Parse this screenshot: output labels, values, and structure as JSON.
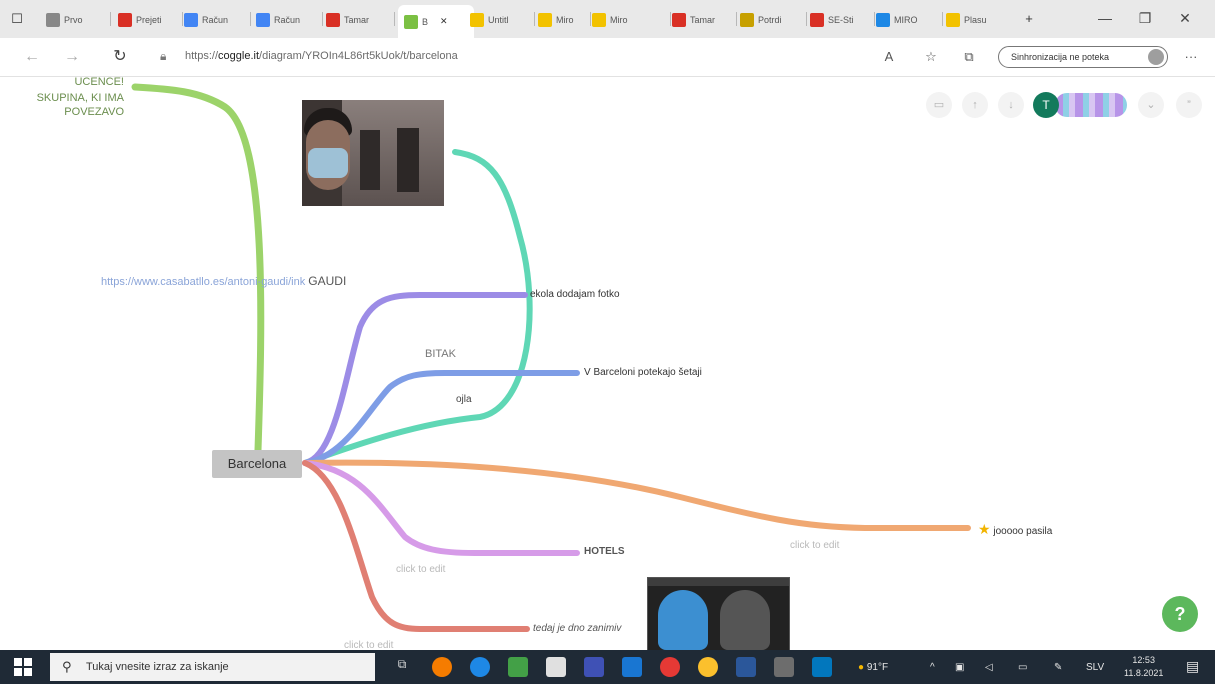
{
  "browser": {
    "tabs": [
      {
        "label": "Prvo",
        "icon": "page-icon",
        "color": "#888888"
      },
      {
        "label": "Prejeti",
        "icon": "gmail-icon",
        "color": "#d93025"
      },
      {
        "label": "Račun",
        "icon": "google-icon",
        "color": "#4285f4"
      },
      {
        "label": "Račun",
        "icon": "google-icon",
        "color": "#4285f4"
      },
      {
        "label": "Tamar",
        "icon": "gmail-icon",
        "color": "#d93025"
      },
      {
        "label": "B",
        "icon": "coggle-icon",
        "color": "#7bc043",
        "active": true
      },
      {
        "label": "Untitl",
        "icon": "miro-icon",
        "color": "#f2c200"
      },
      {
        "label": "Miro",
        "icon": "miro-icon",
        "color": "#f2c200"
      },
      {
        "label": "Miro",
        "icon": "miro-icon",
        "color": "#f2c200"
      },
      {
        "label": "Tamar",
        "icon": "gmail-icon",
        "color": "#d93025"
      },
      {
        "label": "Potrdi",
        "icon": "star-icon",
        "color": "#c7a000"
      },
      {
        "label": "SE-Sti",
        "icon": "pdf-icon",
        "color": "#d93025"
      },
      {
        "label": "MIRO",
        "icon": "bing-icon",
        "color": "#1e88e5"
      },
      {
        "label": "Plasu",
        "icon": "miro-icon",
        "color": "#f2c200"
      }
    ],
    "url_prefix": "https://",
    "url_host": "coggle.it",
    "url_path": "/diagram/YROIn4L86rt5kUok/t/barcelona",
    "sync_label": "Sinhronizacija ne poteka"
  },
  "mindmap": {
    "root": "Barcelona",
    "top_left_note": [
      "UČENCE!",
      "SKUPINA, KI IMA",
      "POVEZAVO"
    ],
    "link_text": "https://www.casabatllo.es/antoni-gaudi/ink",
    "gaudi": "GAUDI",
    "ekola": "ekola dodajam fotko",
    "bitak": "BITAK",
    "barcelona_note": "V Barceloni potekajo šetaji",
    "ojla": "ojla",
    "star_label": "jooooo pasila",
    "hotels": "HOTELS",
    "click_to_edit_1": "click to edit",
    "click_to_edit_2": "click to edit",
    "click_to_edit_3": "click to edit",
    "tedaj": "tedaj je dno zanimiv",
    "user_initial": "T",
    "help": "?",
    "branch_colors": {
      "green": "#9cd36a",
      "teal": "#5fd7b5",
      "purple": "#9c8ce6",
      "blue": "#7e9de6",
      "orange": "#f0a872",
      "pink": "#d69be8",
      "red": "#e07f73"
    }
  },
  "taskbar": {
    "search_placeholder": "Tukaj vnesite izraz za iskanje",
    "weather": "91°F",
    "lang": "SLV",
    "time": "12:53",
    "date": "11.8.2021"
  }
}
